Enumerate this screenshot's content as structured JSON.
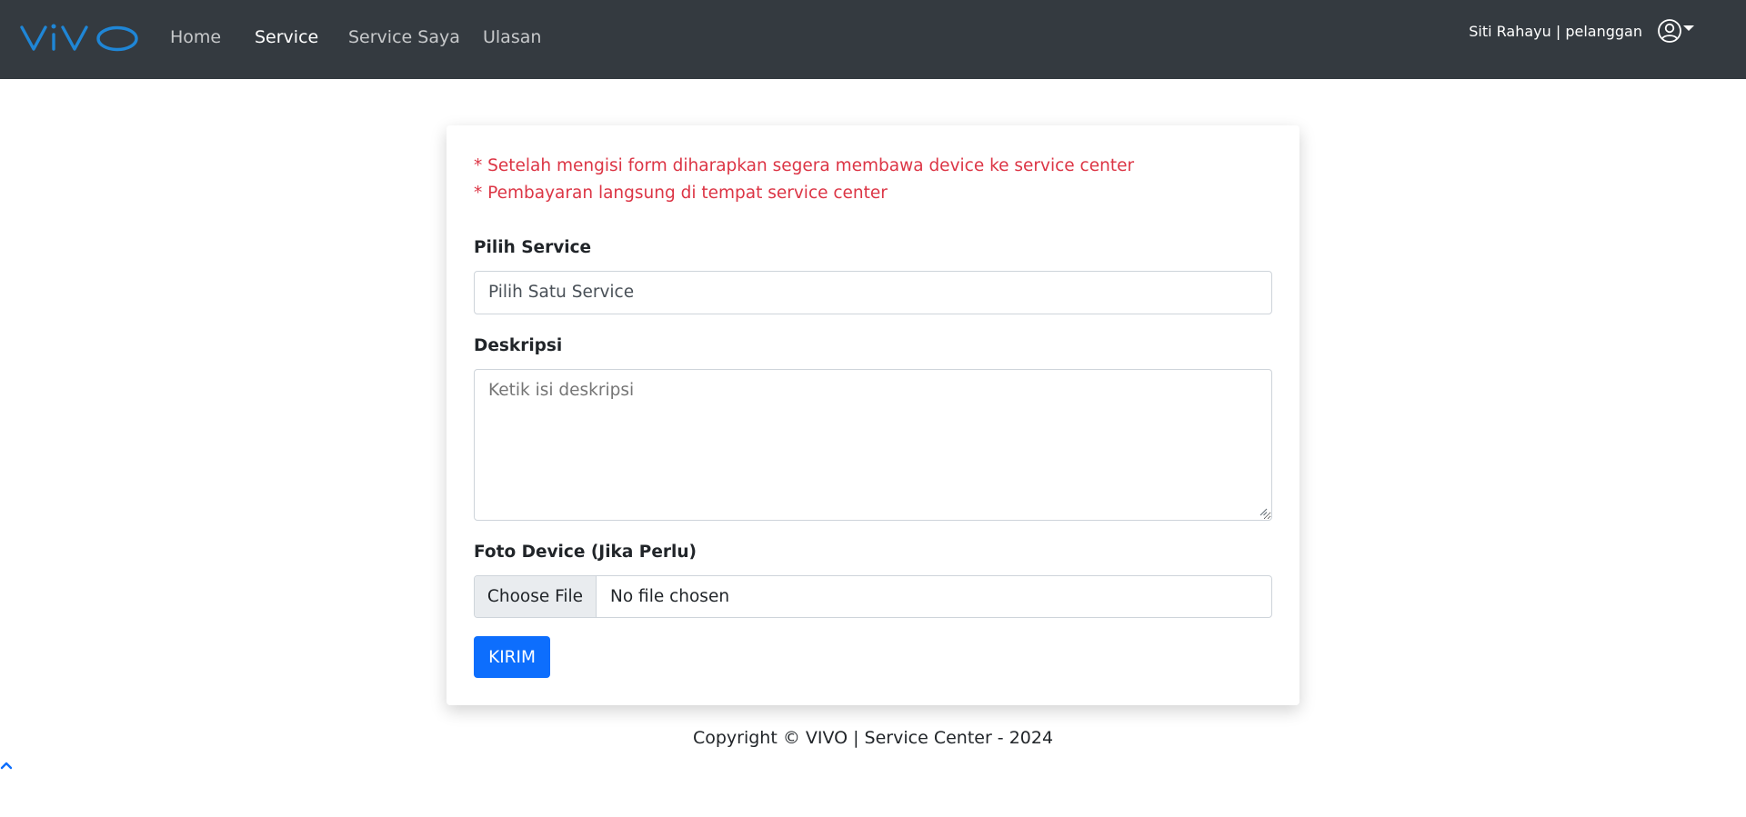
{
  "navbar": {
    "logo_text": "vivo",
    "logo_icon": "vivo-logo",
    "links": [
      {
        "label": "Home",
        "active": false
      },
      {
        "label": "Service",
        "active": true
      },
      {
        "label": "Service Saya",
        "active": false
      },
      {
        "label": "Ulasan",
        "active": false
      }
    ],
    "user_label": "Siti Rahayu | pelanggan",
    "user_icon": "user-circle-icon",
    "caret_icon": "caret-down-icon",
    "background": "#343a40"
  },
  "form": {
    "notes": [
      "* Setelah mengisi form diharapkan segera membawa device ke service center",
      "* Pembayaran langsung di tempat service center"
    ],
    "service": {
      "label": "Pilih Service",
      "selected": "Pilih Satu Service"
    },
    "description": {
      "label": "Deskripsi",
      "value": "",
      "placeholder": "Ketik isi deskripsi"
    },
    "photo": {
      "label": "Foto Device (Jika Perlu)",
      "button_label": "Choose File",
      "status": "No file chosen"
    },
    "submit_label": "KIRIM"
  },
  "footer": {
    "text": "Copyright © VIVO | Service Center - 2024"
  },
  "colors": {
    "accent": "#0d6efd",
    "warning_text": "#dc3545",
    "logo": "#1f86d6"
  },
  "back_to_top_icon": "chevron-up-icon"
}
